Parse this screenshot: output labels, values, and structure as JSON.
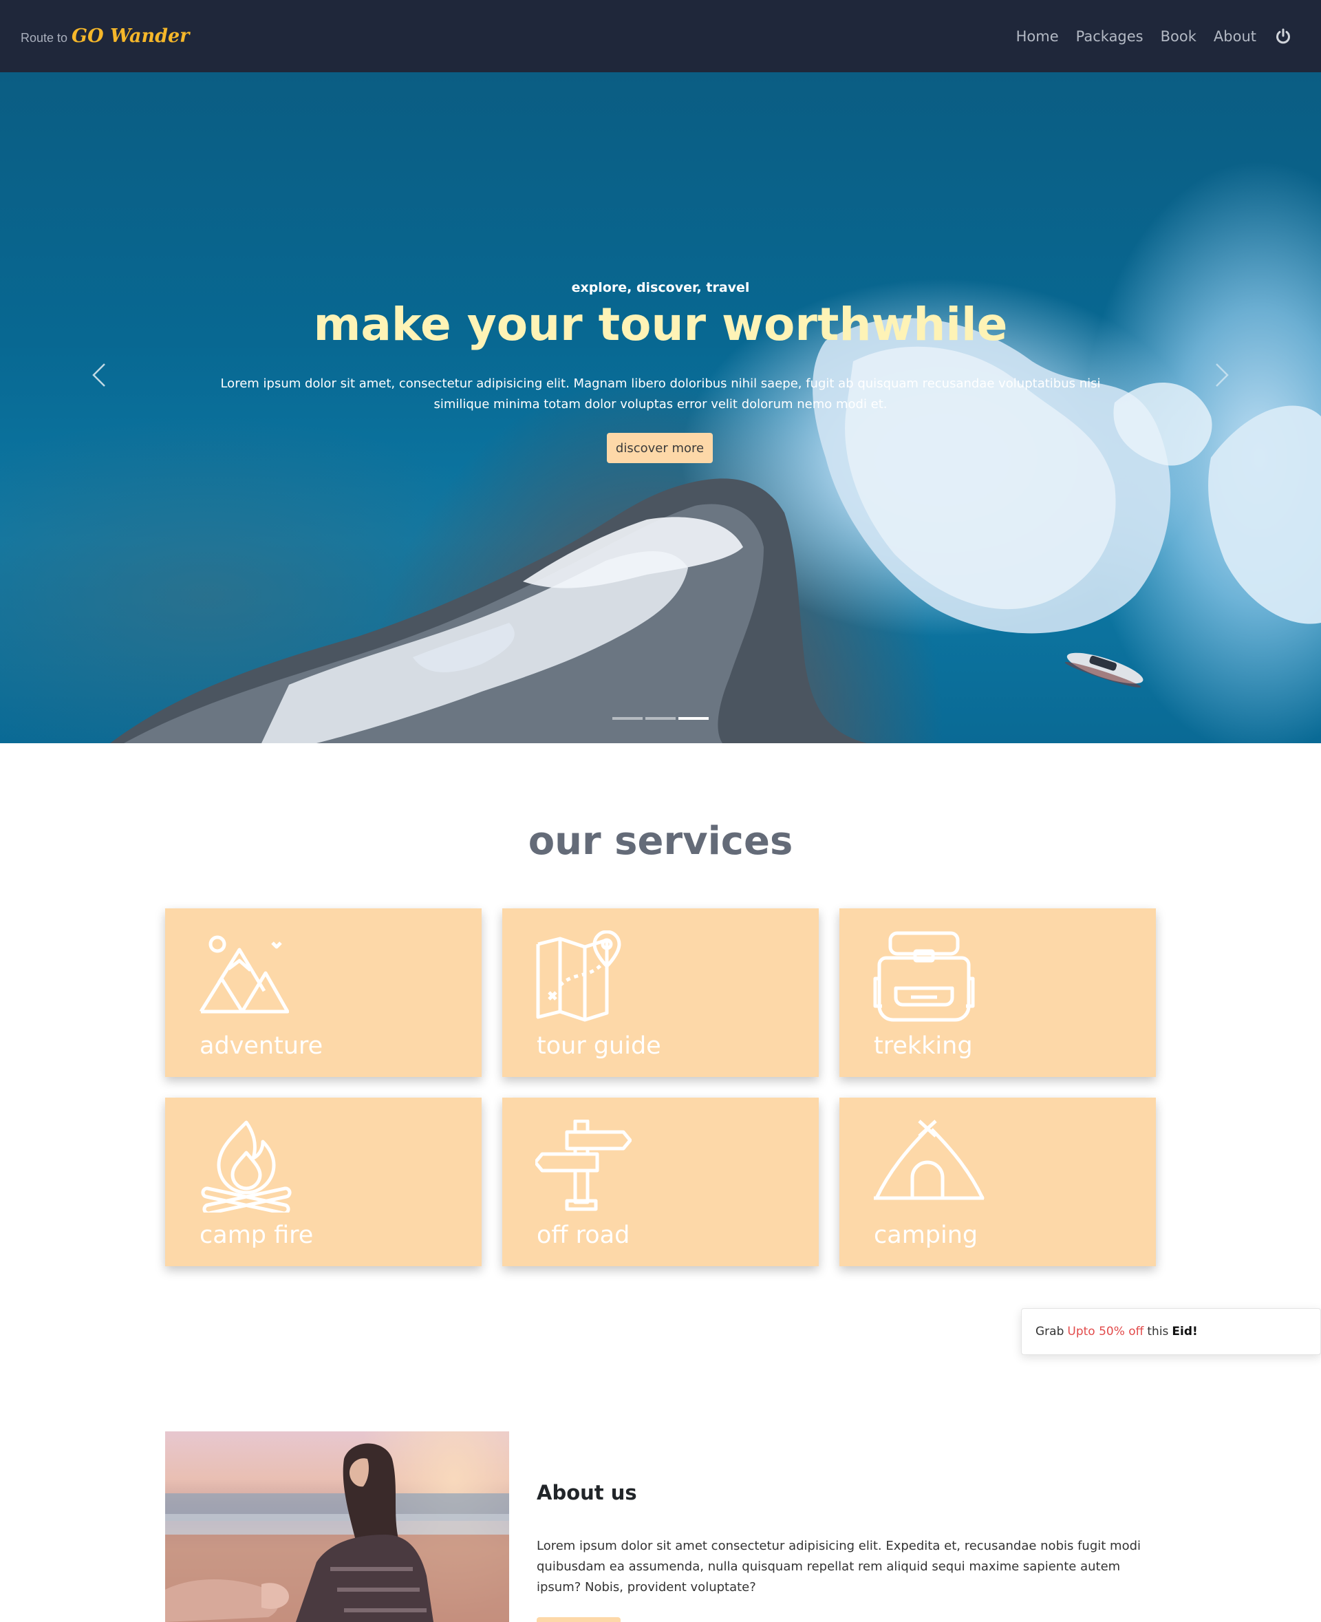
{
  "navbar": {
    "brand_prefix": "Route to",
    "brand_name": "GO Wander",
    "links": [
      "Home",
      "Packages",
      "Book",
      "About"
    ],
    "power_icon": "power-icon",
    "background": "#1f273a",
    "brand_color": "#f5b72a"
  },
  "hero": {
    "subtitle": "explore, discover, travel",
    "title": "make your tour worthwhile",
    "text": "Lorem ipsum dolor sit amet, consectetur adipisicing elit. Magnam libero doloribus nihil saepe, fugit ab quisquam recusandae voluptatibus nisi similique minima totam dolor voluptas error velit dolorum nemo modi et.",
    "button_label": "discover more",
    "prev_icon": "chevron-left-icon",
    "next_icon": "chevron-right-icon",
    "title_color": "#fef3b6"
  },
  "services": {
    "title": "our services",
    "items": [
      {
        "label": "adventure",
        "icon": "mountains-icon"
      },
      {
        "label": "tour guide",
        "icon": "map-icon"
      },
      {
        "label": "trekking",
        "icon": "backpack-icon"
      },
      {
        "label": "camp fire",
        "icon": "campfire-icon"
      },
      {
        "label": "off road",
        "icon": "signpost-icon"
      },
      {
        "label": "camping",
        "icon": "tent-icon"
      }
    ],
    "card_color": "#fdd8a8"
  },
  "toast": {
    "prefix": "Grab",
    "highlight": "Upto 50% off",
    "middle": "this",
    "bold": "Eid!",
    "highlight_color": "#e24b4b"
  },
  "about": {
    "heading": "About us",
    "text": "Lorem ipsum dolor sit amet consectetur adipisicing elit. Expedita et, recusandae nobis fugit modi quibusdam ea assumenda, nulla quisquam repellat rem aliquid sequi maxime sapiente autem ipsum? Nobis, provident voluptate?"
  }
}
